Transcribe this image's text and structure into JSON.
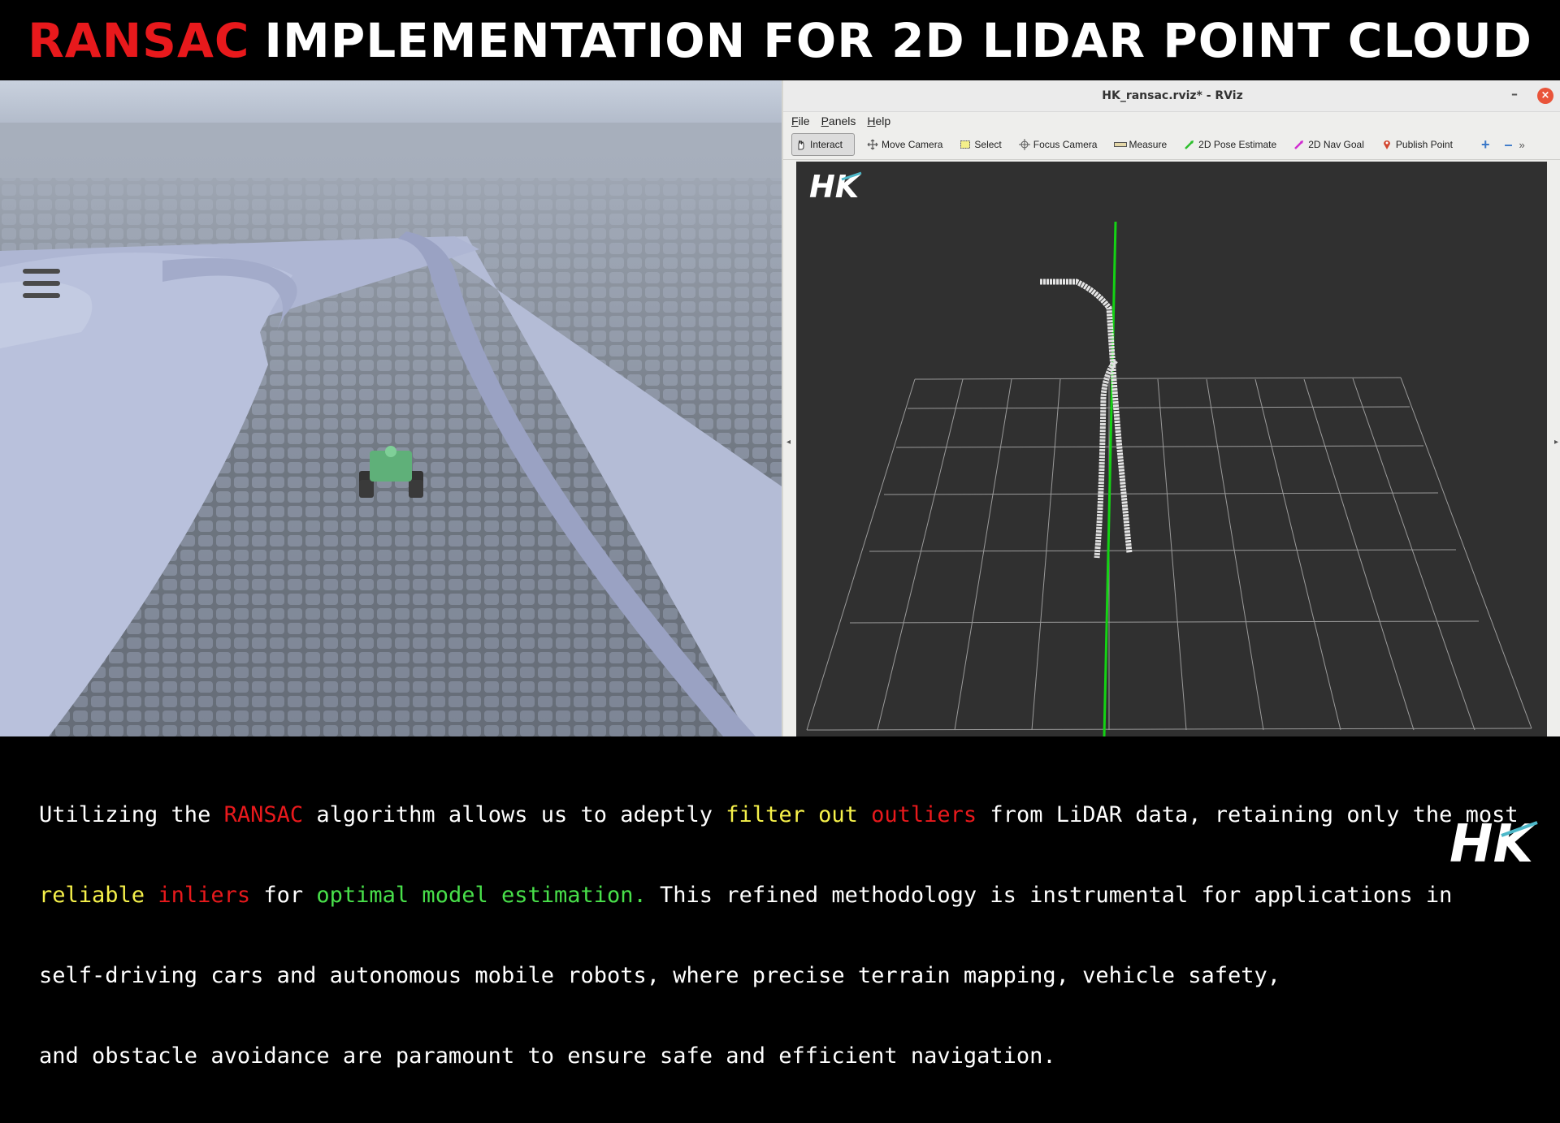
{
  "banner": {
    "accent": "RANSAC",
    "rest": "IMPLEMENTATION FOR 2D LIDAR POINT CLOUD"
  },
  "colors": {
    "accent_red": "#e8191c",
    "highlight_yellow": "#f6f14a",
    "highlight_green": "#48e04a",
    "rviz_background": "#303030",
    "axis_green": "#14d214"
  },
  "sim": {
    "menu_icon": "hamburger-menu-icon"
  },
  "rviz": {
    "title": "HK_ransac.rviz* - RViz",
    "minimize": "–",
    "close": "×",
    "menu": [
      "File",
      "Panels",
      "Help"
    ],
    "tools": [
      {
        "label": "Interact",
        "icon": "hand-cursor-icon"
      },
      {
        "label": "Move Camera",
        "icon": "move-arrows-icon"
      },
      {
        "label": "Select",
        "icon": "select-rectangle-icon"
      },
      {
        "label": "Focus Camera",
        "icon": "focus-crosshair-icon"
      },
      {
        "label": "Measure",
        "icon": "ruler-icon"
      },
      {
        "label": "2D Pose Estimate",
        "icon": "green-arrow-icon"
      },
      {
        "label": "2D Nav Goal",
        "icon": "magenta-arrow-icon"
      },
      {
        "label": "Publish Point",
        "icon": "map-pin-icon"
      }
    ],
    "zoom_in": "+",
    "zoom_out": "–",
    "more": "»",
    "viewport_logo": "HK"
  },
  "caption": {
    "line1": [
      {
        "t": "Utilizing the ",
        "c": ""
      },
      {
        "t": "RANSAC",
        "c": "red"
      },
      {
        "t": " algorithm allows us to adeptly ",
        "c": ""
      },
      {
        "t": "filter out",
        "c": "yellow"
      },
      {
        "t": " ",
        "c": ""
      },
      {
        "t": "outliers",
        "c": "red"
      },
      {
        "t": " from LiDAR data, retaining only the most",
        "c": ""
      }
    ],
    "line2": [
      {
        "t": "reliable",
        "c": "yellow"
      },
      {
        "t": " ",
        "c": ""
      },
      {
        "t": "inliers",
        "c": "red"
      },
      {
        "t": " for ",
        "c": ""
      },
      {
        "t": "optimal model estimation.",
        "c": "green"
      },
      {
        "t": " This refined methodology is instrumental for applications in",
        "c": ""
      }
    ],
    "line3": [
      {
        "t": "self-driving cars and autonomous mobile robots, where precise terrain mapping, vehicle safety,",
        "c": ""
      }
    ],
    "line4": [
      {
        "t": "and obstacle avoidance are paramount to ensure safe and efficient navigation.",
        "c": ""
      }
    ],
    "logo": "HK"
  }
}
